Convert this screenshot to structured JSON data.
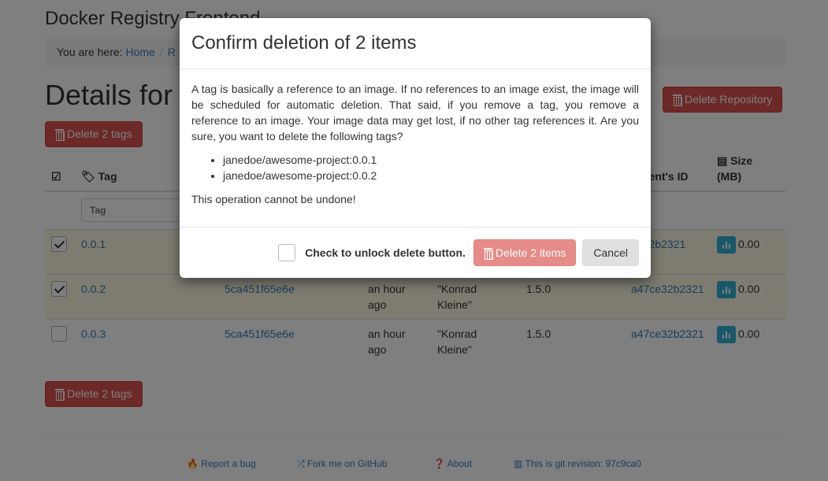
{
  "app_title": "Docker Registry Frontend",
  "breadcrumb": {
    "prefix": "You are here:",
    "items": [
      "Home",
      "R"
    ]
  },
  "page_title": "Details for",
  "delete_tags_label": "Delete 2 tags",
  "delete_repo_label": "Delete Repository",
  "table": {
    "headers": {
      "tag": "Tag",
      "parent": "Parent's ID",
      "size": "Size (MB)"
    },
    "filter_placeholder": "Tag",
    "rows": [
      {
        "selected": true,
        "tag": "0.0.1",
        "image": "",
        "created": "",
        "author": "",
        "docker": "",
        "parent": "ce32b2321",
        "size": "0.00"
      },
      {
        "selected": true,
        "tag": "0.0.2",
        "image": "5ca451f65e6e",
        "created": "an hour ago",
        "author": "\"Konrad Kleine\"",
        "docker": "1.5.0",
        "parent": "a47ce32b2321",
        "size": "0.00"
      },
      {
        "selected": false,
        "tag": "0.0.3",
        "image": "5ca451f65e6e",
        "created": "an hour ago",
        "author": "\"Konrad Kleine\"",
        "docker": "1.5.0",
        "parent": "a47ce32b2321",
        "size": "0.00"
      }
    ]
  },
  "footer": {
    "bug": "Report a bug",
    "fork": "Fork me on GitHub",
    "about": "About",
    "revision": "This is git revision: 97c9ca0"
  },
  "modal": {
    "title": "Confirm deletion of 2 items",
    "body": "A tag is basically a reference to an image. If no references to an image exist, the image will be scheduled for automatic deletion. That said, if you remove a tag, you remove a reference to an image. Your image data may get lost, if no other tag references it. Are you sure, you want to delete the following tags?",
    "items": [
      "janedoe/awesome-project:0.0.1",
      "janedoe/awesome-project:0.0.2"
    ],
    "warning": "This operation cannot be undone!",
    "unlock_label": "Check to unlock delete button.",
    "delete_label": "Delete 2 items",
    "cancel_label": "Cancel"
  },
  "colors": {
    "danger": "#d9534f",
    "link": "#337ab7",
    "selected_row": "#fcf8e3",
    "info": "#31b0d5"
  }
}
